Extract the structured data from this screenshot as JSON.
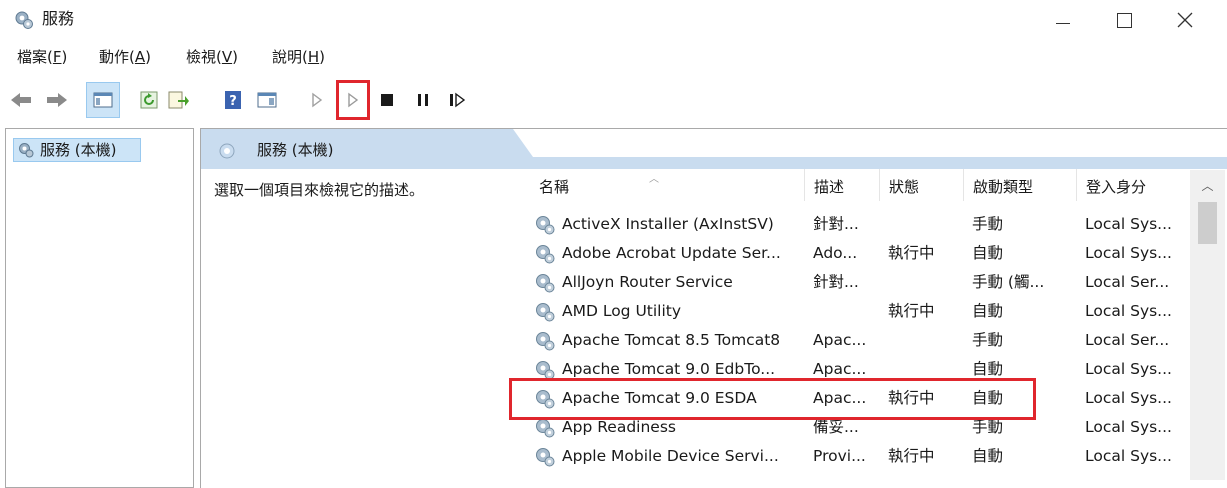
{
  "window": {
    "title": "服務"
  },
  "menu": [
    {
      "label": "檔案",
      "key": "F"
    },
    {
      "label": "動作",
      "key": "A"
    },
    {
      "label": "檢視",
      "key": "V"
    },
    {
      "label": "說明",
      "key": "H"
    }
  ],
  "toolbar": {
    "icons": [
      "back-icon",
      "forward-icon",
      "show-hide-tree-icon",
      "refresh-icon",
      "export-list-icon",
      "help-icon",
      "properties-icon",
      "start-service-icon",
      "start-service-icon",
      "stop-service-icon",
      "pause-service-icon",
      "resume-service-icon"
    ],
    "highlight_color": "#e0262d"
  },
  "tree": {
    "selected_label": "服務 (本機)"
  },
  "pane": {
    "title": "服務 (本機)",
    "description_prompt": "選取一個項目來檢視它的描述。"
  },
  "table": {
    "columns": [
      "名稱",
      "描述",
      "狀態",
      "啟動類型",
      "登入身分"
    ],
    "rows": [
      {
        "name": "ActiveX Installer (AxInstSV)",
        "desc": "針對...",
        "status": "",
        "startup": "手動",
        "logon": "Local Sys..."
      },
      {
        "name": "Adobe Acrobat Update Ser...",
        "desc": "Ado...",
        "status": "執行中",
        "startup": "自動",
        "logon": "Local Sys..."
      },
      {
        "name": "AllJoyn Router Service",
        "desc": "針對...",
        "status": "",
        "startup": "手動 (觸...",
        "logon": "Local Ser..."
      },
      {
        "name": "AMD Log Utility",
        "desc": "",
        "status": "執行中",
        "startup": "自動",
        "logon": "Local Sys..."
      },
      {
        "name": "Apache Tomcat 8.5 Tomcat8",
        "desc": "Apac...",
        "status": "",
        "startup": "手動",
        "logon": "Local Ser..."
      },
      {
        "name": "Apache Tomcat 9.0 EdbTo...",
        "desc": "Apac...",
        "status": "",
        "startup": "自動",
        "logon": "Local Sys..."
      },
      {
        "name": "Apache Tomcat 9.0 ESDA",
        "desc": "Apac...",
        "status": "執行中",
        "startup": "自動",
        "logon": "Local Sys..."
      },
      {
        "name": "App Readiness",
        "desc": "備妥...",
        "status": "",
        "startup": "手動",
        "logon": "Local Sys..."
      },
      {
        "name": "Apple Mobile Device Servi...",
        "desc": "Provi...",
        "status": "執行中",
        "startup": "自動",
        "logon": "Local Sys..."
      }
    ],
    "highlighted_row": "Apache Tomcat 9.0 ESDA"
  },
  "colors": {
    "header_bg": "#c9dcef",
    "selection_bg": "#cce4f7",
    "highlight": "#e0262d"
  }
}
